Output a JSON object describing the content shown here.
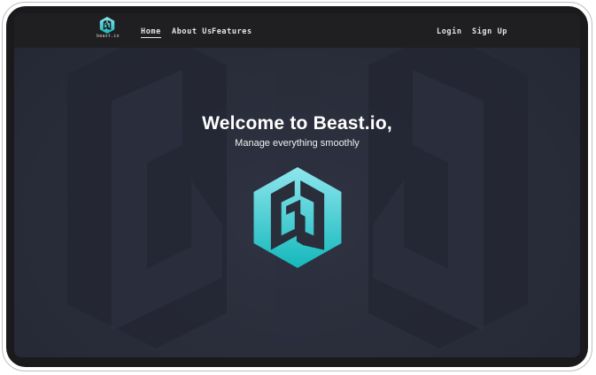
{
  "brand": {
    "name": "beast.io",
    "accent_light": "#8fe6ee",
    "accent_dark": "#13b8bb"
  },
  "nav": {
    "items": [
      {
        "label": "Home",
        "active": true
      },
      {
        "label": "About Us",
        "active": false
      },
      {
        "label": "Features",
        "active": false
      }
    ],
    "login_label": "Login",
    "signup_label": "Sign Up"
  },
  "hero": {
    "title": "Welcome to Beast.io,",
    "subtitle": "Manage everything smoothly"
  },
  "colors": {
    "navbar_bg": "#1f1f21",
    "screen_bg": "#2a2e3b",
    "bezel": "#1a1a1c"
  }
}
